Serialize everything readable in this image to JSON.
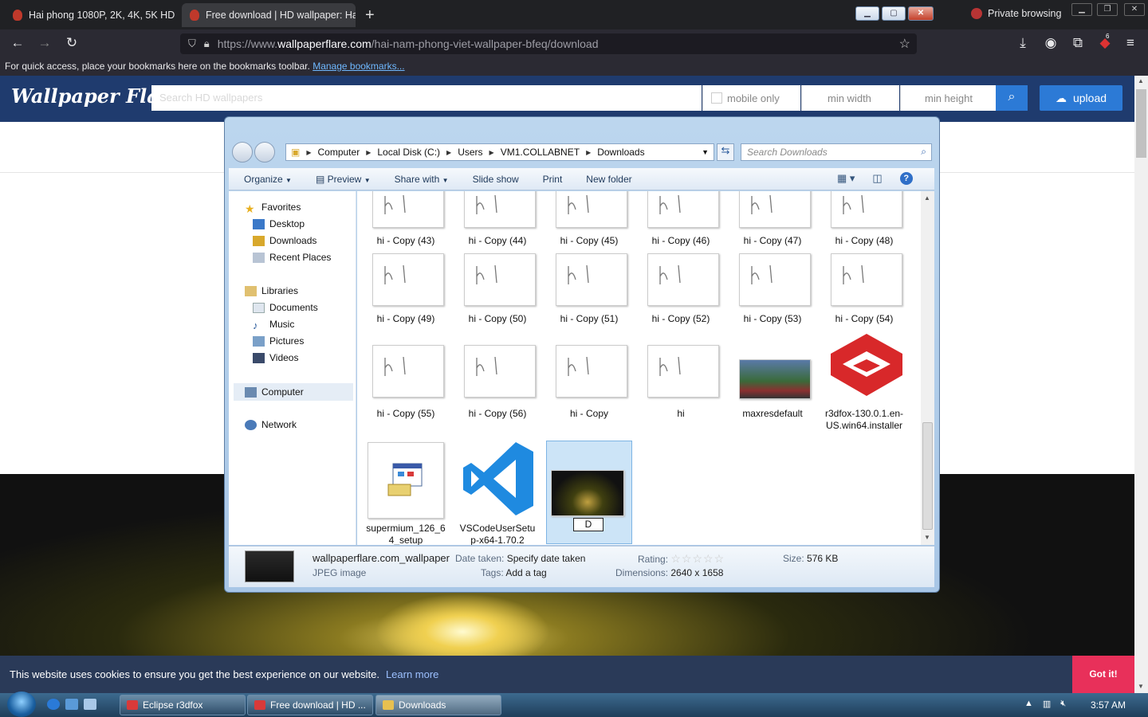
{
  "browser": {
    "tabs": [
      {
        "label": "Hai phong 1080P, 2K, 4K, 5K HD"
      },
      {
        "label": "Free download | HD wallpaper: Ha"
      }
    ],
    "private_label": "Private browsing",
    "url_prefix": "https://www.",
    "url_domain": "wallpaperflare.com",
    "url_path": "/hai-nam-phong-viet-wallpaper-bfeq/download",
    "bookmarks_text": "For quick access, place your bookmarks here on the bookmarks toolbar.",
    "bookmarks_link": "Manage bookmarks...",
    "ext_badge": "6"
  },
  "site": {
    "logo": "Wallpaper Flare",
    "search_placeholder": "Search HD wallpapers",
    "mobile_only": "mobile only",
    "min_width": "min width",
    "min_height": "min height",
    "upload": "upload",
    "cookie_text": "This website uses cookies to ensure you get the best experience on our website.",
    "cookie_learn": "Learn more",
    "cookie_button": "Got it!"
  },
  "explorer": {
    "breadcrumb": [
      "Computer",
      "Local Disk (C:)",
      "Users",
      "VM1.COLLABNET",
      "Downloads"
    ],
    "search_placeholder": "Search Downloads",
    "commands": {
      "organize": "Organize",
      "preview": "Preview",
      "share": "Share with",
      "slideshow": "Slide show",
      "print": "Print",
      "newfolder": "New folder"
    },
    "nav": {
      "favorites": "Favorites",
      "desktop": "Desktop",
      "downloads": "Downloads",
      "recent": "Recent Places",
      "libraries": "Libraries",
      "documents": "Documents",
      "music": "Music",
      "pictures": "Pictures",
      "videos": "Videos",
      "computer": "Computer",
      "network": "Network"
    },
    "files": [
      "hi - Copy (43)",
      "hi - Copy (44)",
      "hi - Copy (45)",
      "hi - Copy (46)",
      "hi - Copy (47)",
      "hi - Copy (48)",
      "hi - Copy (49)",
      "hi - Copy (50)",
      "hi - Copy (51)",
      "hi - Copy (52)",
      "hi - Copy (53)",
      "hi - Copy (54)",
      "hi - Copy (55)",
      "hi - Copy (56)",
      "hi - Copy",
      "hi",
      "maxresdefault",
      "r3dfox-130.0.1.en-US.win64.installer",
      "supermium_126_64_setup",
      "VSCodeUserSetup-x64-1.70.2",
      "D"
    ],
    "details": {
      "name": "wallpaperflare.com_wallpaper",
      "type": "JPEG image",
      "date_label": "Date taken:",
      "date_value": "Specify date taken",
      "tags_label": "Tags:",
      "tags_value": "Add a tag",
      "rating_label": "Rating:",
      "dimensions_label": "Dimensions:",
      "dimensions_value": "2640 x 1658",
      "size_label": "Size:",
      "size_value": "576 KB"
    }
  },
  "taskbar": {
    "items": [
      "Eclipse r3dfox",
      "Free download | HD ...",
      "Downloads"
    ],
    "clock": "3:57 AM"
  },
  "colors": {
    "wf_header": "#1f3b6e",
    "accent": "#2c7ad6",
    "cookie_button": "#e8305a"
  }
}
